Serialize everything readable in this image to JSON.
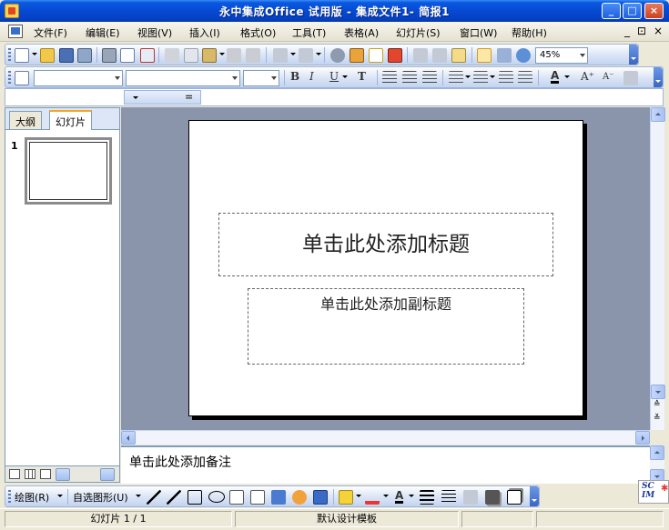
{
  "window": {
    "title": "永中集成Office 试用版 - 集成文件1- 简报1",
    "minimize_glyph": "_",
    "maximize_glyph": "□",
    "close_glyph": "×"
  },
  "menubar": {
    "items": [
      "文件(F)",
      "编辑(E)",
      "视图(V)",
      "插入(I)",
      "格式(O)",
      "工具(T)",
      "表格(A)",
      "幻灯片(S)",
      "窗口(W)",
      "帮助(H)"
    ],
    "right_glyphs": [
      "_",
      "⊡",
      "×"
    ]
  },
  "standard_toolbar": {
    "zoom_value": "45%"
  },
  "side_pane": {
    "tabs": [
      "大纲",
      "幻灯片"
    ],
    "active_tab": "幻灯片",
    "slide_number": "1"
  },
  "slide": {
    "title_placeholder": "单击此处添加标题",
    "subtitle_placeholder": "单击此处添加副标题"
  },
  "scroll_glyphs": {
    "prev_slide": "≙",
    "next_slide": "≚"
  },
  "notes": {
    "placeholder": "单击此处添加备注"
  },
  "drawing_toolbar": {
    "draw_label": "绘图(R)",
    "autoshapes_label": "自选图形(U)"
  },
  "ime": {
    "text": "SC IM",
    "star": "✱"
  },
  "statusbar": {
    "slide_info": "幻灯片 1 / 1",
    "template": "默认设计模板"
  },
  "colors": {
    "titlebar": "#0648D1",
    "slide_background": "#8A94AA",
    "toolbar_gradient_end": "#C3D4F0"
  }
}
